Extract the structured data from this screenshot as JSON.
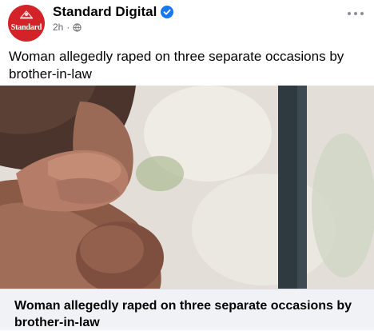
{
  "post": {
    "page_name": "Standard Digital",
    "avatar_text": "Standard",
    "time": "2h",
    "separator": "·",
    "caption": "Woman allegedly raped on three separate occasions by brother-in-law",
    "link_title": "Woman allegedly raped on three separate occasions by brother-in-law"
  },
  "icons": {
    "verified": "verified-badge-icon",
    "audience": "globe-icon",
    "more": "more-options-icon"
  },
  "colors": {
    "brand_red": "#d32329",
    "verified_blue": "#1877f2",
    "secondary_text": "#65676b",
    "link_bg": "#f0f2f5"
  }
}
